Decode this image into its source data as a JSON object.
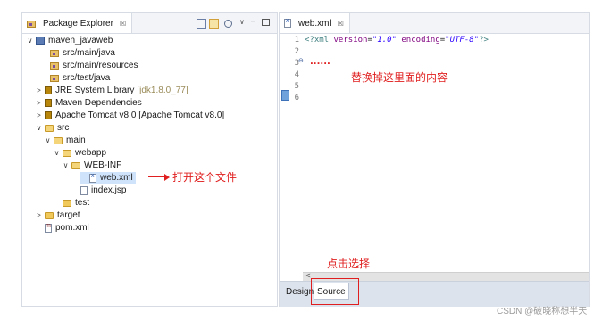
{
  "package_explorer": {
    "title": "Package Explorer",
    "close_glyph": "☒",
    "toolbar_icons": [
      "collapse-all-icon",
      "link-with-editor-icon",
      "filter-icon",
      "view-menu-icon",
      "minimize-icon",
      "maximize-icon"
    ],
    "tree": [
      {
        "twisty": "∨",
        "icon": "project",
        "label": "maven_javaweb"
      },
      {
        "twisty": "",
        "icon": "pkgfolder",
        "label": "src/main/java"
      },
      {
        "twisty": "",
        "icon": "pkgfolder",
        "label": "src/main/resources"
      },
      {
        "twisty": "",
        "icon": "pkgfolder",
        "label": "src/test/java"
      },
      {
        "twisty": ">",
        "icon": "lib",
        "label": "JRE System Library",
        "decoration": "[jdk1.8.0_77]"
      },
      {
        "twisty": ">",
        "icon": "lib",
        "label": "Maven Dependencies"
      },
      {
        "twisty": ">",
        "icon": "lib",
        "label": "Apache Tomcat v8.0 [Apache Tomcat v8.0]"
      },
      {
        "twisty": "∨",
        "icon": "folder-open",
        "label": "src"
      },
      {
        "twisty": "∨",
        "icon": "folder-open",
        "label": "main"
      },
      {
        "twisty": "∨",
        "icon": "folder-open",
        "label": "webapp"
      },
      {
        "twisty": "∨",
        "icon": "folder-open",
        "label": "WEB-INF"
      },
      {
        "twisty": "",
        "icon": "xml",
        "label": "web.xml"
      },
      {
        "twisty": "",
        "icon": "file",
        "label": "index.jsp"
      },
      {
        "twisty": "",
        "icon": "folder",
        "label": "test"
      },
      {
        "twisty": ">",
        "icon": "folder",
        "label": "target"
      },
      {
        "twisty": "",
        "icon": "pom",
        "label": "pom.xml"
      }
    ]
  },
  "editor": {
    "tab_title": "web.xml",
    "close_glyph": "☒",
    "line_numbers": [
      "1",
      "2",
      "3",
      "4",
      "5",
      "6"
    ],
    "fold_marker": "⊖",
    "code_line1": {
      "open": "<?xml ",
      "attr1": "version",
      "eq1": "=",
      "val1": "\"1.0\"",
      "sp": " ",
      "attr2": "encoding",
      "eq2": "=",
      "val2": "\"UTF-8\"",
      "close": "?>"
    },
    "bottom_tabs": {
      "design": "Design",
      "source": "Source"
    },
    "scroll_left_arrow": "<"
  },
  "annotations": {
    "open_file": "打开这个文件",
    "replace_content": "替换掉这里面的内容",
    "dots": "......",
    "click_select": "点击选择",
    "watermark": "CSDN @破晓称想半天"
  },
  "colors": {
    "annotation_red": "#e02020",
    "selection_blue": "#cfe3fb"
  }
}
